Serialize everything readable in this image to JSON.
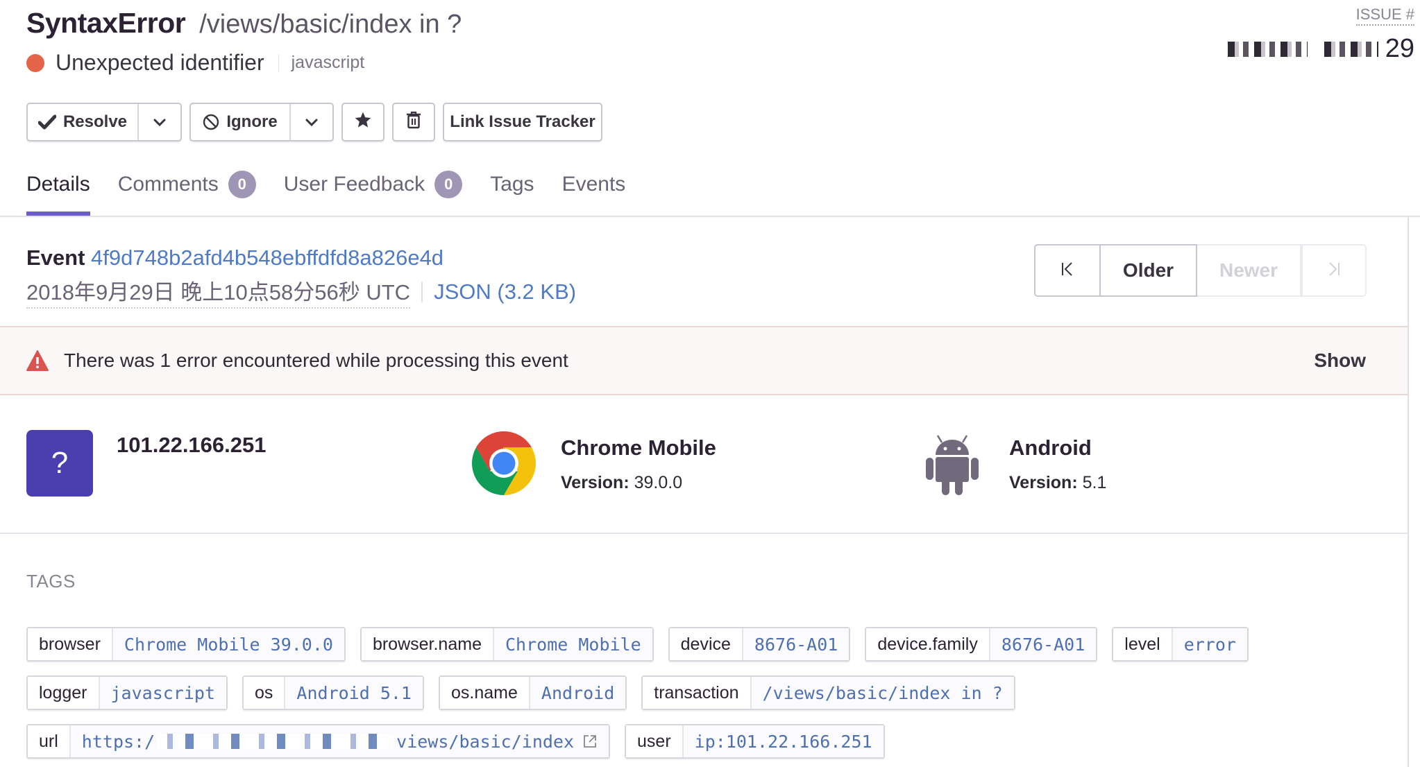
{
  "header": {
    "error_type": "SyntaxError",
    "location": "/views/basic/index in ?",
    "message": "Unexpected identifier",
    "platform": "javascript",
    "issue_label": "ISSUE #",
    "issue_number_visible": "29",
    "colors": {
      "error_dot": "#e4644a",
      "accent": "#6c5fc7",
      "link": "#4e7ac7"
    }
  },
  "actions": {
    "resolve_label": "Resolve",
    "ignore_label": "Ignore",
    "link_tracker_label": "Link Issue Tracker",
    "icons": [
      "checkmark-icon",
      "chevron-down-icon",
      "ignore-icon",
      "star-icon",
      "trash-icon"
    ]
  },
  "tabs": [
    {
      "label": "Details",
      "active": true
    },
    {
      "label": "Comments",
      "count": "0"
    },
    {
      "label": "User Feedback",
      "count": "0"
    },
    {
      "label": "Tags"
    },
    {
      "label": "Events"
    }
  ],
  "event": {
    "label": "Event",
    "id": "4f9d748b2afd4b548ebffdfd8a826e4d",
    "timestamp": "2018年9月29日 晚上10点58分56秒 UTC",
    "json_link": "JSON (3.2 KB)"
  },
  "pager": {
    "first_symbol": "K",
    "older_label": "Older",
    "newer_label": "Newer",
    "last_symbol": ">I"
  },
  "error_banner": {
    "text": "There was 1 error encountered while processing this event",
    "show_label": "Show"
  },
  "context": {
    "user": {
      "icon_symbol": "?",
      "ip": "101.22.166.251"
    },
    "browser": {
      "name": "Chrome Mobile",
      "version_label": "Version:",
      "version": "39.0.0"
    },
    "os": {
      "name": "Android",
      "version_label": "Version:",
      "version": "5.1"
    }
  },
  "tags_section": {
    "title": "TAGS",
    "tags": [
      {
        "key": "browser",
        "value": "Chrome Mobile 39.0.0"
      },
      {
        "key": "browser.name",
        "value": "Chrome Mobile"
      },
      {
        "key": "device",
        "value": "8676-A01"
      },
      {
        "key": "device.family",
        "value": "8676-A01"
      },
      {
        "key": "level",
        "value": "error"
      },
      {
        "key": "logger",
        "value": "javascript"
      },
      {
        "key": "os",
        "value": "Android 5.1"
      },
      {
        "key": "os.name",
        "value": "Android"
      },
      {
        "key": "transaction",
        "value": "/views/basic/index in ?"
      },
      {
        "key": "url",
        "value_prefix": "https:/",
        "value_suffix": "views/basic/index"
      },
      {
        "key": "user",
        "value": "ip:101.22.166.251"
      }
    ]
  }
}
